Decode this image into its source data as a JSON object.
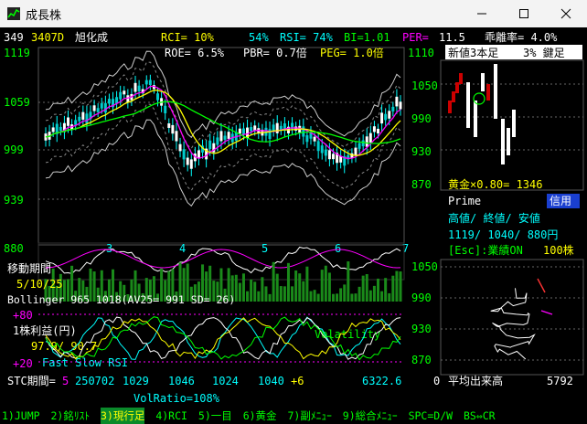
{
  "window": {
    "title": "成長株",
    "icon": "chart-app-icon"
  },
  "header": {
    "code_num": "349",
    "code": "3407D",
    "name": "旭化成",
    "rci": "RCI=  10%",
    "rci2": "54%",
    "rsi": "RSI= 74%",
    "bi": "BI=1.01",
    "per_label": "PER=",
    "per": "11.5",
    "deviation": "乖離率=  4.0%",
    "roe": "ROE=  6.5%",
    "pbr": "PBR= 0.7倍",
    "peg": "PEG= 1.0倍"
  },
  "price_axis": [
    "1119",
    "1059",
    "999",
    "939",
    "880"
  ],
  "month_labels": [
    "3",
    "4",
    "5",
    "6",
    "7"
  ],
  "left_panel": {
    "moving_period_label": "移動期間",
    "moving_period": "5/10/25",
    "bollinger": "Bollinger  965  1018(AV25= 991 SD=  26)",
    "plus80": "+80",
    "eps_label": "1株利益(円)",
    "eps_values": "97.9/  90.7",
    "volatility": "Volatility",
    "plus20": "+20",
    "stochastics": "Fast Slow RSI",
    "stc_label": "STC期間=",
    "stc_period": "5",
    "stc_date": "250702",
    "stc_values": [
      "1029",
      "1046",
      "1024",
      "1040",
      "+6"
    ],
    "volume_total": "6322.6",
    "vol_ratio": "VolRatio=108%"
  },
  "right_panel": {
    "axis_top": "1110",
    "axis": [
      "1050",
      "990",
      "930",
      "870"
    ],
    "header_left": "新値3本足",
    "header_right": "3% 鍵足",
    "gold_label": "黄金×0.80= 1346",
    "prime": "Prime",
    "credit": "信用",
    "hl_labels": "高値/ 終値/ 安値",
    "hl_values": "1119/ 1040/   880円",
    "esc": "[Esc]:業績ON",
    "lot": "100株",
    "lower_axis": [
      "1050",
      "990",
      "930",
      "870"
    ],
    "bottom_label": "平均出来高",
    "bottom_value": "5792",
    "bottom_zero": "0"
  },
  "statusbar": {
    "items": [
      "1)JUMP",
      "2)銘ﾘｽﾄ",
      "3)現行足",
      "4)RCI",
      "5)一目",
      "6)黄金",
      "7)副ﾒﾆｭｰ",
      "9)総合ﾒﾆｭｰ",
      "SPC=D/W",
      "BS⇔CR"
    ]
  },
  "colors": {
    "bg": "#000000",
    "green": "#00ff00",
    "yellow": "#ffff00",
    "cyan": "#00ffff",
    "magenta": "#ff00ff",
    "white": "#ffffff"
  }
}
